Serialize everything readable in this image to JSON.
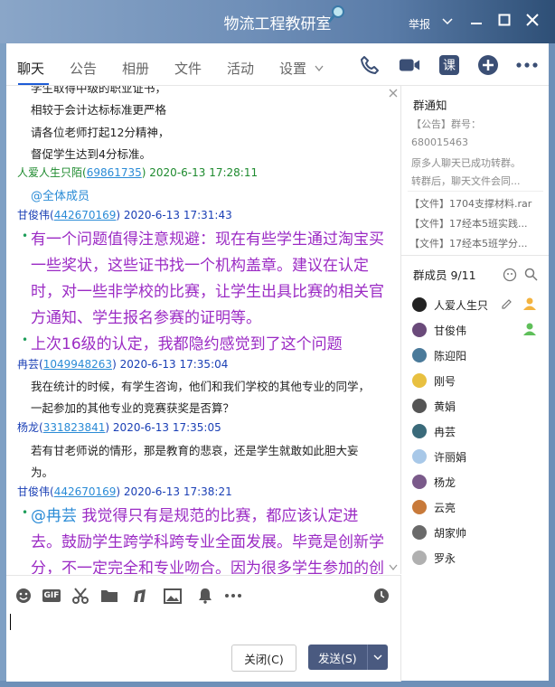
{
  "window": {
    "title": "物流工程教研室",
    "report": "举报"
  },
  "tabs": [
    {
      "label": "聊天"
    },
    {
      "label": "公告"
    },
    {
      "label": "相册"
    },
    {
      "label": "文件"
    },
    {
      "label": "活动"
    },
    {
      "label": "设置"
    }
  ],
  "toolbar": {
    "class_label": "课"
  },
  "chat": {
    "prev_lines": [
      "学生取得中级的职业证书，",
      "相较于会计达标标准更严格",
      "请各位老师打起12分精神，",
      "督促学生达到4分标准。"
    ],
    "messages": [
      {
        "sender": "人爱人生只陌",
        "qq": "69861735",
        "time": "2020-6-13 17:28:11",
        "lines": [
          "@全体成员"
        ]
      },
      {
        "sender": "甘俊伟",
        "qq": "442670169",
        "time": "2020-6-13 17:31:43",
        "lines": [
          "有一个问题值得注意规避：现在有些学生通过淘宝买",
          "一些奖状，这些证书找一个机构盖章。建议在认定",
          "时，对一些非学校的比赛，让学生出具比赛的相关官",
          "方通知、学生报名参赛的证明等。",
          "上次16级的认定，我都隐约感觉到了这个问题"
        ]
      },
      {
        "sender": "冉芸",
        "qq": "1049948263",
        "time": "2020-6-13 17:35:04",
        "lines": [
          "我在统计的时候，有学生咨询，他们和我们学校的其他专业的同学，",
          "一起参加的其他专业的竞赛获奖是否算？"
        ]
      },
      {
        "sender": "杨龙",
        "qq": "331823841",
        "time": "2020-6-13 17:35:05",
        "lines": [
          "若有甘老师说的情形，那是教育的悲哀，还是学生就敢如此胆大妄",
          "为。"
        ]
      },
      {
        "sender": "甘俊伟",
        "qq": "442670169",
        "time": "2020-6-13 17:38:21",
        "mention": "@冉芸",
        "lines": [
          "我觉得只有是规范的比赛，都应该认定进",
          "去。鼓励学生跨学科跨专业全面发展。毕竟是创新学",
          "分，不一定完全和专业吻合。因为很多学生参加的创"
        ]
      }
    ]
  },
  "composer": {
    "gif_label": "GIF",
    "close_label": "关闭(C)",
    "send_label": "发送(S)"
  },
  "sidebar": {
    "notice_title": "群通知",
    "notice_lines": [
      "【公告】群号：",
      "680015463",
      "原多人聊天已成功转群。",
      "转群后，聊天文件会同...",
      "【文件】1704支撑材料.rar",
      "【文件】17经本5班实践...",
      "【文件】17经本5班学分..."
    ],
    "members_title": "群成员 9/11",
    "members": [
      "人爱人生只",
      "甘俊伟",
      "陈迎阳",
      "刚号",
      "黄娟",
      "冉芸",
      "许丽娟",
      "杨龙",
      "云亮",
      "胡家帅",
      "罗永"
    ]
  },
  "colors": {
    "accent": "#1d5bd6",
    "send_button": "#4a5a80",
    "message_purple": "#9b2bc4",
    "link_blue": "#2a8bd6",
    "sender_green": "#1e8a2e"
  }
}
